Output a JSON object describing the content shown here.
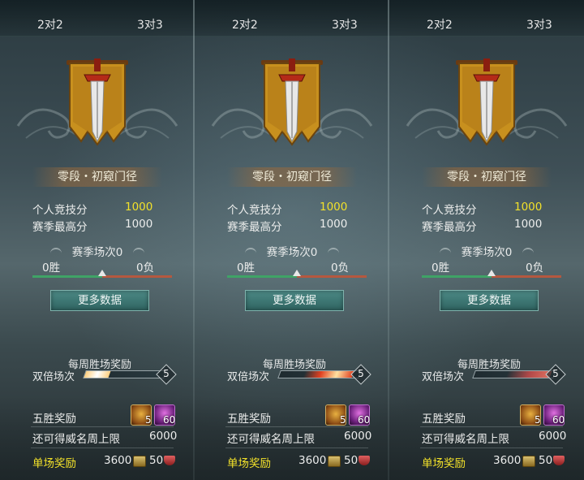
{
  "panels": [
    {
      "tabs": {
        "left": "2对2",
        "right": "3对3"
      },
      "rank_name": "零段・初窥门径",
      "personal_score_label": "个人竞技分",
      "personal_score_value": "1000",
      "season_high_label": "赛季最高分",
      "season_high_value": "1000",
      "season_matches_label": "赛季场次0",
      "wins": "0胜",
      "losses": "0负",
      "more_data_button": "更多数据",
      "weekly_title": "每周胜场奖励",
      "double_label": "双倍场次",
      "double_progress_max": "5",
      "five_win_label": "五胜奖励",
      "five_win_items": [
        {
          "icon": "treasure-chest",
          "count": "5"
        },
        {
          "icon": "purple-gem",
          "count": "60"
        }
      ],
      "fame_cap_label": "还可得威名周上限",
      "fame_cap_value": "6000",
      "single_reward_label": "单场奖励",
      "single_reward_coins": "3600",
      "single_reward_shield": "50"
    },
    {
      "tabs": {
        "left": "2对2",
        "right": "3对3"
      },
      "rank_name": "零段・初窥门径",
      "personal_score_label": "个人竞技分",
      "personal_score_value": "1000",
      "season_high_label": "赛季最高分",
      "season_high_value": "1000",
      "season_matches_label": "赛季场次0",
      "wins": "0胜",
      "losses": "0负",
      "more_data_button": "更多数据",
      "weekly_title": "每周胜场奖励",
      "double_label": "双倍场次",
      "double_progress_max": "5",
      "five_win_label": "五胜奖励",
      "five_win_items": [
        {
          "icon": "treasure-chest",
          "count": "5"
        },
        {
          "icon": "purple-gem",
          "count": "60"
        }
      ],
      "fame_cap_label": "还可得威名周上限",
      "fame_cap_value": "6000",
      "single_reward_label": "单场奖励",
      "single_reward_coins": "3600",
      "single_reward_shield": "50"
    },
    {
      "tabs": {
        "left": "2对2",
        "right": "3对3"
      },
      "rank_name": "零段・初窥门径",
      "personal_score_label": "个人竞技分",
      "personal_score_value": "1000",
      "season_high_label": "赛季最高分",
      "season_high_value": "1000",
      "season_matches_label": "赛季场次0",
      "wins": "0胜",
      "losses": "0负",
      "more_data_button": "更多数据",
      "weekly_title": "每周胜场奖励",
      "double_label": "双倍场次",
      "double_progress_max": "5",
      "five_win_label": "五胜奖励",
      "five_win_items": [
        {
          "icon": "treasure-chest",
          "count": "5"
        },
        {
          "icon": "purple-gem",
          "count": "60"
        }
      ],
      "fame_cap_label": "还可得威名周上限",
      "fame_cap_value": "6000",
      "single_reward_label": "单场奖励",
      "single_reward_coins": "3600",
      "single_reward_shield": "50"
    }
  ],
  "colors": {
    "gold_text": "#f2e12a",
    "win_bar": "#3fa366",
    "loss_bar": "#b5583f",
    "button": "#3e7774"
  }
}
